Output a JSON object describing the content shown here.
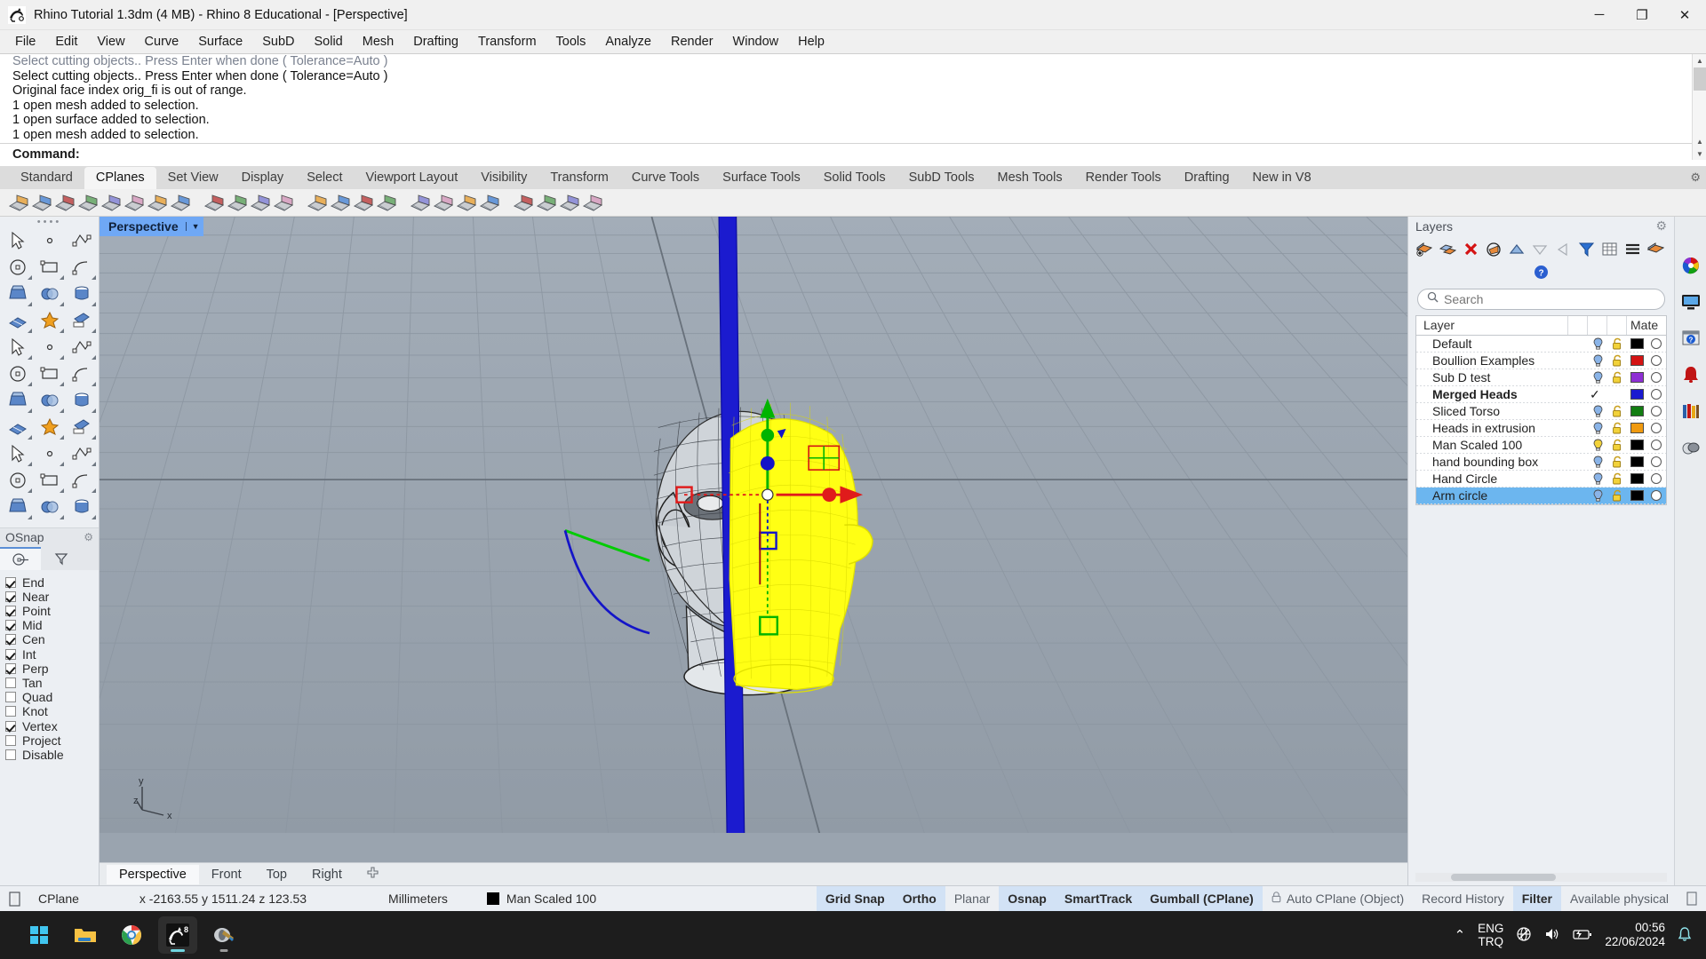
{
  "window": {
    "title": "Rhino Tutorial 1.3dm (4 MB) - Rhino 8 Educational - [Perspective]",
    "app_icon": "rhino-icon",
    "minimize": "─",
    "maximize": "❐",
    "close": "✕"
  },
  "menubar": {
    "items": [
      "File",
      "Edit",
      "View",
      "Curve",
      "Surface",
      "SubD",
      "Solid",
      "Mesh",
      "Drafting",
      "Transform",
      "Tools",
      "Analyze",
      "Render",
      "Window",
      "Help"
    ]
  },
  "command_area": {
    "history": [
      {
        "text": "Select cutting objects.. Press Enter when done ( Tolerance=Auto )",
        "faded": true
      },
      {
        "text": "Select cutting objects.. Press Enter when done ( Tolerance=Auto )",
        "faded": false
      },
      {
        "text": "Original face index orig_fi is out of range.",
        "faded": false
      },
      {
        "text": "1 open mesh added to selection.",
        "faded": false
      },
      {
        "text": "1 open surface added to selection.",
        "faded": false
      },
      {
        "text": "1 open mesh added to selection.",
        "faded": false
      }
    ],
    "prompt": "Command:",
    "input_value": ""
  },
  "toolbar_tabs": {
    "items": [
      "Standard",
      "CPlanes",
      "Set View",
      "Display",
      "Select",
      "Viewport Layout",
      "Visibility",
      "Transform",
      "Curve Tools",
      "Surface Tools",
      "Solid Tools",
      "SubD Tools",
      "Mesh Tools",
      "Render Tools",
      "Drafting",
      "New in V8"
    ],
    "active": "CPlanes"
  },
  "icon_toolbar": {
    "icons": [
      "cplane-set-icon",
      "cplane-origin-icon",
      "cplane-elevation-icon",
      "cplane-object-icon",
      "cplane-surface-icon",
      "cplane-curve-icon",
      "cplane-perp-icon",
      "cplane-3point-icon",
      "cplane-rotate-icon",
      "cplane-next-icon",
      "cplane-named-icon",
      "cplane-save-icon",
      "cplane-grid-icon",
      "cplane-open-icon",
      "cplane-world-icon",
      "cplane-view-icon",
      "cplane-top-icon",
      "cplane-front-icon",
      "cplane-right-icon",
      "cplane-universal-icon",
      "cplane-align-icon",
      "cplane-match-icon",
      "cplane-undo-icon",
      "cplane-redo-icon"
    ]
  },
  "left_palette": {
    "tools": [
      "select-arrow-icon",
      "point-icon",
      "polyline-icon",
      "curve-interp-icon",
      "circle-icon",
      "ellipse-icon",
      "arc-icon",
      "rectangle-icon",
      "polygon-icon",
      "fillet-curve-icon",
      "surface-edit-points-icon",
      "surface-loft-icon",
      "box-icon",
      "sphere-boolean-icon",
      "cylinder-icon",
      "mesh-plane-icon",
      "boolean-union-icon",
      "explode-icon",
      "extract-surface-icon",
      "split-icon",
      "boolean-difference-icon",
      "curve-boolean-icon",
      "blend-curve-icon",
      "offset-curve-icon",
      "text-icon",
      "scale-icon",
      "array-icon",
      "mirror-icon",
      "box-edit-icon",
      "extrude-icon",
      "grid-array-icon",
      "section-icon",
      "more-tools-icon"
    ]
  },
  "osnap": {
    "title": "OSnap",
    "gear": "gear-icon",
    "tabs": [
      "osnap-target-icon",
      "osnap-filter-icon"
    ],
    "active_tab": 0,
    "options": [
      {
        "label": "End",
        "checked": true
      },
      {
        "label": "Near",
        "checked": true
      },
      {
        "label": "Point",
        "checked": true
      },
      {
        "label": "Mid",
        "checked": true
      },
      {
        "label": "Cen",
        "checked": true
      },
      {
        "label": "Int",
        "checked": true
      },
      {
        "label": "Perp",
        "checked": true
      },
      {
        "label": "Tan",
        "checked": false
      },
      {
        "label": "Quad",
        "checked": false
      },
      {
        "label": "Knot",
        "checked": false
      },
      {
        "label": "Vertex",
        "checked": true
      },
      {
        "label": "Project",
        "checked": false
      },
      {
        "label": "Disable",
        "checked": false
      }
    ]
  },
  "viewport": {
    "label": "Perspective",
    "dropdown_arrow": "▼",
    "axis_labels": {
      "x": "x",
      "y": "y",
      "z": "z"
    },
    "tabs": [
      "Perspective",
      "Front",
      "Top",
      "Right"
    ],
    "active_tab": "Perspective",
    "add_tab_icon": "add-viewport-icon",
    "scene": {
      "objects": [
        "head-mesh-wireframe-gray",
        "head-mesh-wireframe-yellow-selected",
        "blue-cutting-plane",
        "gumball-widget",
        "red-green-grid-marker"
      ],
      "gumball": {
        "x_axis_color": "#e01b1b",
        "y_axis_color": "#00b400",
        "z_axis_color": "#1a1ad0",
        "selected_object_color": "#ffff00"
      },
      "background_color": "#9aa4af",
      "grid_color": "#8b959f"
    }
  },
  "layers_panel": {
    "title": "Layers",
    "gear": "gear-icon",
    "toolbar_icons": [
      "new-layer-icon",
      "new-sublayer-icon",
      "delete-layer-icon",
      "layer-properties-icon",
      "move-up-icon",
      "move-down-icon",
      "move-left-icon",
      "filter-icon",
      "grid-view-icon",
      "menu-icon",
      "current-layer-icon",
      "help-icon"
    ],
    "search_placeholder": "Search",
    "search_value": "",
    "columns": [
      "Layer",
      "",
      "",
      "",
      "",
      "Mate"
    ],
    "rows": [
      {
        "name": "Default",
        "current": false,
        "visible": true,
        "locked": false,
        "color": "#000000",
        "selected": false
      },
      {
        "name": "Boullion Examples",
        "current": false,
        "visible": true,
        "locked": false,
        "color": "#d41313",
        "selected": false
      },
      {
        "name": "Sub D test",
        "current": false,
        "visible": true,
        "locked": false,
        "color": "#8e2fd4",
        "selected": false
      },
      {
        "name": "Merged Heads",
        "current": true,
        "visible": true,
        "locked": false,
        "color": "#1a1ad0",
        "selected": false
      },
      {
        "name": "Sliced Torso",
        "current": false,
        "visible": true,
        "locked": false,
        "color": "#127d12",
        "selected": false
      },
      {
        "name": "Heads in extrusion",
        "current": false,
        "visible": true,
        "locked": false,
        "color": "#f09a10",
        "selected": false
      },
      {
        "name": "Man Scaled 100",
        "current": false,
        "visible": true,
        "locked": false,
        "color": "#000000",
        "selected": false,
        "bulb_on": true
      },
      {
        "name": "hand bounding box",
        "current": false,
        "visible": true,
        "locked": false,
        "color": "#000000",
        "selected": false
      },
      {
        "name": "Hand Circle",
        "current": false,
        "visible": true,
        "locked": false,
        "color": "#000000",
        "selected": false
      },
      {
        "name": "Arm circle",
        "current": false,
        "visible": true,
        "locked": false,
        "color": "#000000",
        "selected": true
      }
    ],
    "current_check": "✓"
  },
  "right_rail": {
    "icons": [
      "color-wheel-icon",
      "display-monitor-icon",
      "help-panel-icon",
      "notifications-bell-icon",
      "library-icon",
      "render-materials-icon"
    ]
  },
  "statusbar": {
    "lock_icon": "toggle-icon",
    "cplane_label": "CPlane",
    "coords": "x -2163.55  y 1511.24  z 123.53",
    "units": "Millimeters",
    "layer_swatch_color": "#000000",
    "current_layer": "Man Scaled 100",
    "toggles": [
      {
        "label": "Grid Snap",
        "on": true
      },
      {
        "label": "Ortho",
        "on": true
      },
      {
        "label": "Planar",
        "on": false
      },
      {
        "label": "Osnap",
        "on": true
      },
      {
        "label": "SmartTrack",
        "on": true
      },
      {
        "label": "Gumball (CPlane)",
        "on": true
      },
      {
        "label": "Auto CPlane (Object)",
        "on": false,
        "icon": "lock-icon"
      },
      {
        "label": "Record History",
        "on": false
      },
      {
        "label": "Filter",
        "on": true
      },
      {
        "label": "Available physical",
        "on": false
      }
    ]
  },
  "taskbar": {
    "apps": [
      {
        "name": "start-button-icon",
        "active": false
      },
      {
        "name": "file-explorer-icon",
        "active": false
      },
      {
        "name": "chrome-icon",
        "active": false
      },
      {
        "name": "rhino-icon",
        "active": true
      },
      {
        "name": "rhino-render-icon",
        "active": false
      }
    ],
    "tray": {
      "chevron": "⌃",
      "language_top": "ENG",
      "language_bottom": "TRQ",
      "network_icon": "network-globe-icon",
      "volume_icon": "volume-icon",
      "battery_icon": "battery-icon",
      "time": "00:56",
      "date": "22/06/2024",
      "bell_icon": "notification-bell-icon"
    }
  }
}
